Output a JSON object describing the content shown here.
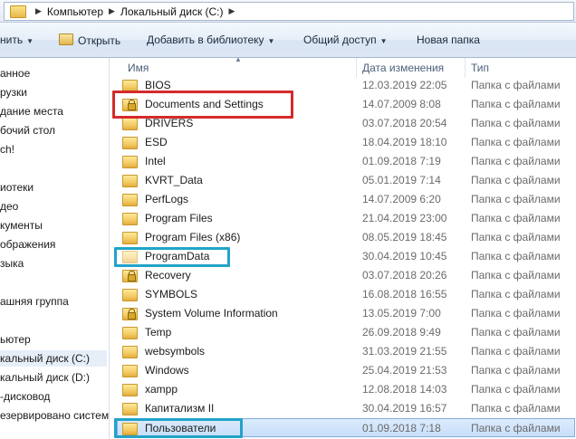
{
  "address": {
    "crumbs": [
      "Компьютер",
      "Локальный диск (C:)"
    ]
  },
  "toolbar": {
    "organize": "нить",
    "open": "Открыть",
    "add_library": "Добавить в библиотеку",
    "share": "Общий доступ",
    "new_folder": "Новая папка"
  },
  "nav": {
    "items": [
      "анное",
      "рузки",
      "дание места",
      "бочий стол",
      "ch!",
      "иотеки",
      "део",
      "кументы",
      "ображения",
      "зыка",
      "ашняя группа",
      "ьютер",
      "кальный диск (C:)",
      "кальный диск (D:)",
      "-дисковод",
      "езервировано систем"
    ],
    "selected_index": 12
  },
  "columns": {
    "name": "Имя",
    "date": "Дата изменения",
    "type": "Тип"
  },
  "files": [
    {
      "name": "BIOS",
      "date": "12.03.2019 22:05",
      "type": "Папка с файлами",
      "locked": false,
      "hidden": false
    },
    {
      "name": "Documents and Settings",
      "date": "14.07.2009 8:08",
      "type": "Папка с файлами",
      "locked": true,
      "hidden": false
    },
    {
      "name": "DRIVERS",
      "date": "03.07.2018 20:54",
      "type": "Папка с файлами",
      "locked": false,
      "hidden": false
    },
    {
      "name": "ESD",
      "date": "18.04.2019 18:10",
      "type": "Папка с файлами",
      "locked": false,
      "hidden": false
    },
    {
      "name": "Intel",
      "date": "01.09.2018 7:19",
      "type": "Папка с файлами",
      "locked": false,
      "hidden": false
    },
    {
      "name": "KVRT_Data",
      "date": "05.01.2019 7:14",
      "type": "Папка с файлами",
      "locked": false,
      "hidden": false
    },
    {
      "name": "PerfLogs",
      "date": "14.07.2009 6:20",
      "type": "Папка с файлами",
      "locked": false,
      "hidden": false
    },
    {
      "name": "Program Files",
      "date": "21.04.2019 23:00",
      "type": "Папка с файлами",
      "locked": false,
      "hidden": false
    },
    {
      "name": "Program Files (x86)",
      "date": "08.05.2019 18:45",
      "type": "Папка с файлами",
      "locked": false,
      "hidden": false
    },
    {
      "name": "ProgramData",
      "date": "30.04.2019 10:45",
      "type": "Папка с файлами",
      "locked": false,
      "hidden": true
    },
    {
      "name": "Recovery",
      "date": "03.07.2018 20:26",
      "type": "Папка с файлами",
      "locked": true,
      "hidden": false
    },
    {
      "name": "SYMBOLS",
      "date": "16.08.2018 16:55",
      "type": "Папка с файлами",
      "locked": false,
      "hidden": false
    },
    {
      "name": "System Volume Information",
      "date": "13.05.2019 7:00",
      "type": "Папка с файлами",
      "locked": true,
      "hidden": false
    },
    {
      "name": "Temp",
      "date": "26.09.2018 9:49",
      "type": "Папка с файлами",
      "locked": false,
      "hidden": false
    },
    {
      "name": "websymbols",
      "date": "31.03.2019 21:55",
      "type": "Папка с файлами",
      "locked": false,
      "hidden": false
    },
    {
      "name": "Windows",
      "date": "25.04.2019 21:53",
      "type": "Папка с файлами",
      "locked": false,
      "hidden": false
    },
    {
      "name": "xampp",
      "date": "12.08.2018 14:03",
      "type": "Папка с файлами",
      "locked": false,
      "hidden": false
    },
    {
      "name": "Капитализм II",
      "date": "30.04.2019 16:57",
      "type": "Папка с файлами",
      "locked": false,
      "hidden": false
    },
    {
      "name": "Пользователи",
      "date": "01.09.2018 7:18",
      "type": "Папка с файлами",
      "locked": false,
      "hidden": false
    }
  ],
  "selected_file_index": 18,
  "highlights": [
    {
      "file_index": 1,
      "color": "#d42a2a"
    },
    {
      "file_index": 9,
      "color": "#22a3c8"
    },
    {
      "file_index": 18,
      "color": "#22a3c8"
    }
  ]
}
